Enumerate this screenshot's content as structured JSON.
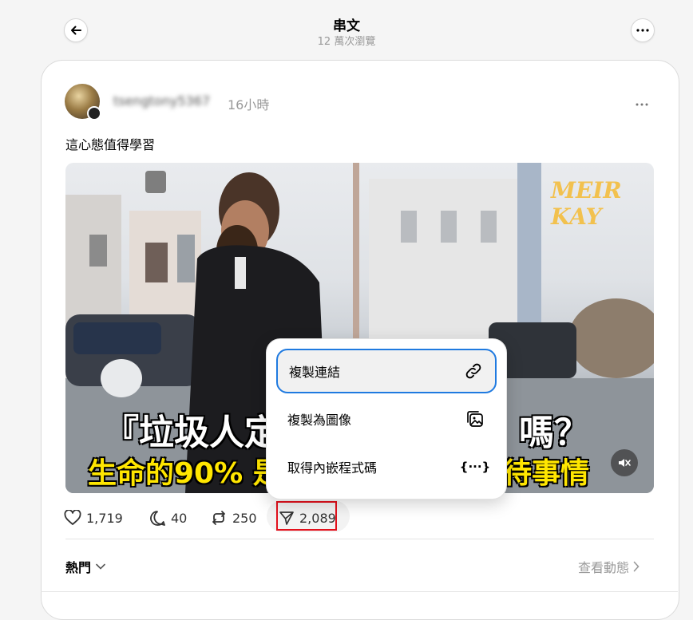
{
  "header": {
    "title": "串文",
    "views": "12 萬次瀏覽"
  },
  "post": {
    "username": "tsengtony5367",
    "timestamp": "16小時",
    "caption": "這心態值得學習",
    "video": {
      "subtitle_line1_left": "『垃圾人定",
      "subtitle_line1_right": "嗎？",
      "subtitle_line2_left": "生命的90% 是",
      "subtitle_line2_right": "待事情",
      "watermark": "MEIR KAY"
    },
    "actions": {
      "likes": "1,719",
      "comments": "40",
      "reposts": "250",
      "shares": "2,089"
    }
  },
  "share_menu": {
    "items": [
      {
        "label": "複製連結",
        "icon": "link-icon"
      },
      {
        "label": "複製為圖像",
        "icon": "image-icon"
      },
      {
        "label": "取得內嵌程式碼",
        "icon": "embed-code-icon"
      }
    ],
    "embed_glyph": "{···}"
  },
  "footer": {
    "sort_label": "熱門",
    "activity_label": "查看動態"
  },
  "colors": {
    "accent_border": "#1f7ae0",
    "highlight_box": "#e3101c",
    "subtitle_yellow": "#ffe600"
  }
}
